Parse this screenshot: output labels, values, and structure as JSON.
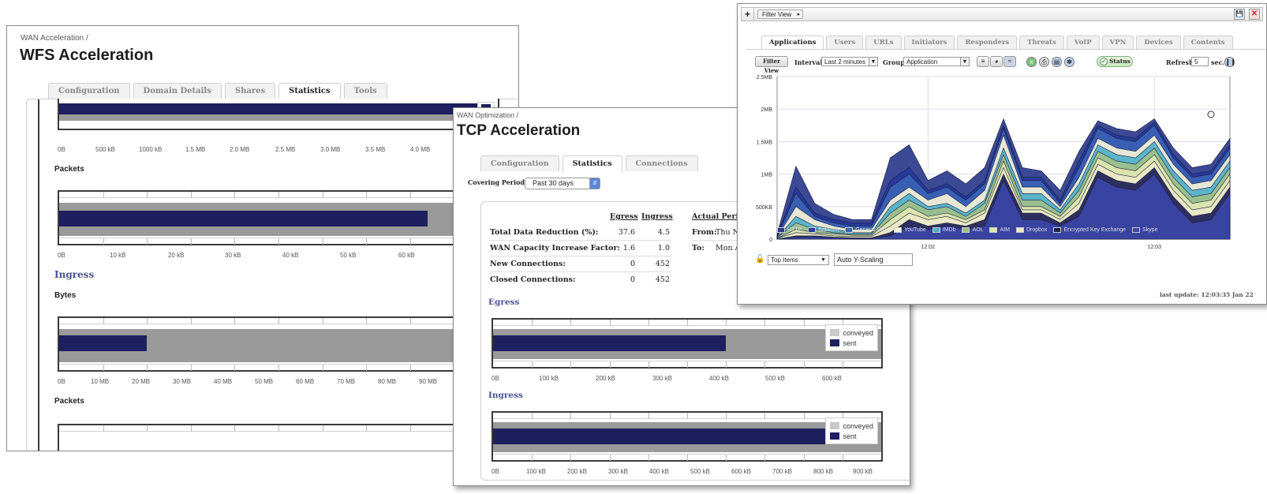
{
  "wfs": {
    "breadcrumb": "WAN Acceleration /",
    "title": "WFS Acceleration",
    "tabs": [
      "Configuration",
      "Domain Details",
      "Shares",
      "Statistics",
      "Tools"
    ],
    "active_tab": "Statistics",
    "axis1": [
      "0B",
      "500 kB",
      "1000 kB",
      "1.5 MB",
      "2.0 MB",
      "2.5 MB",
      "3.0 MB",
      "3.5 MB",
      "4.0 MB"
    ],
    "packets_label": "Packets",
    "axis2": [
      "0B",
      "10 kB",
      "20 kB",
      "30 kB",
      "40 kB",
      "50 kB",
      "60 kB"
    ],
    "ingress_label": "Ingress",
    "bytes_label": "Bytes",
    "axis3": [
      "0B",
      "10 MB",
      "20 MB",
      "30 MB",
      "40 MB",
      "50 MB",
      "60 MB",
      "70 MB",
      "80 MB",
      "90 MB"
    ],
    "packets2_label": "Packets",
    "bar1_sent_fraction": 0.97,
    "bar2_sent_fraction": 0.84,
    "bar3_sent_fraction": 0.2
  },
  "tcp": {
    "breadcrumb": "WAN Optimization /",
    "title": "TCP Acceleration",
    "tabs": [
      "Configuration",
      "Statistics",
      "Connections"
    ],
    "active_tab": "Statistics",
    "period_label": "Covering Period:",
    "period_value": "Past 30 days",
    "headers": {
      "egress": "Egress",
      "ingress": "Ingress",
      "actual": "Actual Perio"
    },
    "rows": [
      {
        "label": "Total Data Reduction (%):",
        "egress": "37.6",
        "ingress": "4.5"
      },
      {
        "label": "WAN Capacity Increase Factor:",
        "egress": "1.6",
        "ingress": "1.0"
      },
      {
        "label": "New Connections:",
        "egress": "0",
        "ingress": "452"
      },
      {
        "label": "Closed Connections:",
        "egress": "0",
        "ingress": "452"
      }
    ],
    "from_label": "From:",
    "from_value": "Thu N",
    "to_label": "To:",
    "to_value": "Mon A",
    "egress_label": "Egress",
    "ingress_label": "Ingress",
    "legend": {
      "conveyed": "conveyed",
      "sent": "sent"
    },
    "axis_egress": [
      "0B",
      "100 kB",
      "200 kB",
      "300 kB",
      "400 kB",
      "500 kB",
      "600 kB"
    ],
    "axis_ingress": [
      "0B",
      "100 kB",
      "200 kB",
      "300 kB",
      "400 kB",
      "500 kB",
      "600 kB",
      "700 kB",
      "800 kB",
      "900 kB"
    ],
    "egress_sent_fraction": 0.6,
    "ingress_sent_fraction": 0.96
  },
  "dash": {
    "filter_view": "Filter View",
    "tabs": [
      "Applications",
      "Users",
      "URLs",
      "Initiators",
      "Responders",
      "Threats",
      "VoIP",
      "VPN",
      "Devices",
      "Contents"
    ],
    "active_tab": "Applications",
    "filter_button": "Filter View",
    "interval_label": "Interval:",
    "interval_value": "Last 2 minutes",
    "group_label": "Group:",
    "group_value": "Application",
    "status_label": "Status",
    "refresh_label": "Refresh:",
    "refresh_value": "5",
    "refresh_unit": "sec.",
    "top_items": "Top Items",
    "auto_scaling": "Auto Y-Scaling",
    "last_update": "last update: 12:03:35 Jan 22",
    "chart_data": {
      "type": "area",
      "y_ticks": [
        "0",
        "500KB",
        "1MB",
        "1.5MB",
        "2MB",
        "2.5MB"
      ],
      "x_ticks": [
        "12:02",
        "12:03"
      ],
      "ylim": [
        0,
        2.5
      ],
      "x": [
        0,
        1,
        2,
        3,
        4,
        5,
        6,
        7,
        8,
        9,
        10,
        11,
        12,
        13,
        14,
        15,
        16,
        17,
        18,
        19,
        20,
        21,
        22,
        23,
        24
      ],
      "series": [
        {
          "name": "HTTP",
          "color": "#2b3a8c",
          "values": [
            0.08,
            1.12,
            0.55,
            0.38,
            0.3,
            0.3,
            1.25,
            1.45,
            0.9,
            1.05,
            0.85,
            1.1,
            1.85,
            1.1,
            1.05,
            0.75,
            1.35,
            1.82,
            1.7,
            1.65,
            1.85,
            1.4,
            1.1,
            1.15,
            1.55
          ]
        },
        {
          "name": "Bittorent",
          "color": "#25399c",
          "values": [
            0.05,
            0.8,
            0.4,
            0.3,
            0.25,
            0.25,
            0.9,
            1.1,
            0.75,
            0.85,
            0.65,
            0.9,
            1.75,
            0.95,
            0.95,
            0.6,
            1.2,
            1.75,
            1.6,
            1.55,
            1.8,
            1.3,
            1.0,
            1.05,
            1.45
          ]
        },
        {
          "name": "General URL",
          "color": "#3a63b5",
          "values": [
            0.04,
            0.7,
            0.35,
            0.25,
            0.2,
            0.2,
            0.8,
            1.0,
            0.7,
            0.8,
            0.6,
            0.85,
            1.7,
            0.9,
            0.9,
            0.55,
            1.1,
            1.7,
            1.55,
            1.5,
            1.75,
            1.25,
            0.95,
            1.0,
            1.4
          ]
        },
        {
          "name": "YouTube",
          "color": "#f5f3d8",
          "values": [
            0.03,
            0.5,
            0.3,
            0.2,
            0.15,
            0.15,
            0.6,
            0.8,
            0.6,
            0.7,
            0.5,
            0.75,
            1.6,
            0.8,
            0.8,
            0.5,
            0.95,
            1.55,
            1.4,
            1.35,
            1.6,
            1.15,
            0.85,
            0.9,
            1.3
          ]
        },
        {
          "name": "IMDb",
          "color": "#4fb0c8",
          "values": [
            0.02,
            0.35,
            0.2,
            0.15,
            0.1,
            0.1,
            0.5,
            0.7,
            0.5,
            0.55,
            0.4,
            0.6,
            1.4,
            0.7,
            0.7,
            0.45,
            0.85,
            1.45,
            1.3,
            1.25,
            1.5,
            1.05,
            0.75,
            0.8,
            1.2
          ]
        },
        {
          "name": "AOL",
          "color": "#9fc08a",
          "values": [
            0.02,
            0.25,
            0.15,
            0.1,
            0.08,
            0.08,
            0.4,
            0.6,
            0.45,
            0.5,
            0.35,
            0.55,
            1.3,
            0.6,
            0.6,
            0.4,
            0.75,
            1.35,
            1.2,
            1.15,
            1.4,
            0.95,
            0.65,
            0.7,
            1.1
          ]
        },
        {
          "name": "AIM",
          "color": "#dfe7b0",
          "values": [
            0.01,
            0.15,
            0.1,
            0.08,
            0.06,
            0.06,
            0.3,
            0.5,
            0.35,
            0.4,
            0.3,
            0.45,
            1.2,
            0.5,
            0.5,
            0.35,
            0.65,
            1.25,
            1.1,
            1.05,
            1.3,
            0.85,
            0.55,
            0.6,
            1.0
          ]
        },
        {
          "name": "Dropbox",
          "color": "#ece8c8",
          "values": [
            0.01,
            0.1,
            0.08,
            0.05,
            0.04,
            0.04,
            0.2,
            0.4,
            0.3,
            0.35,
            0.25,
            0.4,
            1.1,
            0.45,
            0.45,
            0.3,
            0.55,
            1.15,
            1.0,
            0.95,
            1.2,
            0.75,
            0.45,
            0.5,
            0.9
          ]
        },
        {
          "name": "Encrypted Key Exchange",
          "color": "#1c1f55",
          "values": [
            0.0,
            0.05,
            0.05,
            0.03,
            0.02,
            0.02,
            0.1,
            0.3,
            0.2,
            0.25,
            0.2,
            0.3,
            1.0,
            0.4,
            0.4,
            0.25,
            0.45,
            1.05,
            0.9,
            0.85,
            1.1,
            0.65,
            0.35,
            0.4,
            0.8
          ]
        },
        {
          "name": "Skype",
          "color": "#3b46a8",
          "values": [
            0.0,
            0.03,
            0.03,
            0.02,
            0.01,
            0.01,
            0.05,
            0.2,
            0.15,
            0.2,
            0.15,
            0.2,
            0.9,
            0.3,
            0.3,
            0.2,
            0.35,
            0.95,
            0.8,
            0.75,
            1.0,
            0.55,
            0.25,
            0.3,
            0.7
          ]
        }
      ]
    }
  }
}
